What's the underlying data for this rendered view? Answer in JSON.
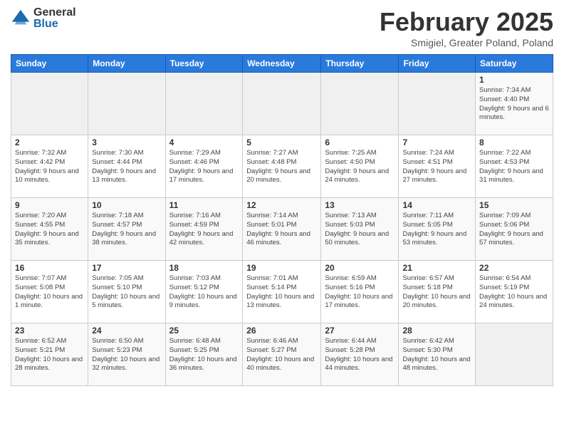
{
  "header": {
    "logo_general": "General",
    "logo_blue": "Blue",
    "month_title": "February 2025",
    "location": "Smigiel, Greater Poland, Poland"
  },
  "days_of_week": [
    "Sunday",
    "Monday",
    "Tuesday",
    "Wednesday",
    "Thursday",
    "Friday",
    "Saturday"
  ],
  "weeks": [
    [
      {
        "day": "",
        "info": ""
      },
      {
        "day": "",
        "info": ""
      },
      {
        "day": "",
        "info": ""
      },
      {
        "day": "",
        "info": ""
      },
      {
        "day": "",
        "info": ""
      },
      {
        "day": "",
        "info": ""
      },
      {
        "day": "1",
        "info": "Sunrise: 7:34 AM\nSunset: 4:40 PM\nDaylight: 9 hours and 6 minutes."
      }
    ],
    [
      {
        "day": "2",
        "info": "Sunrise: 7:32 AM\nSunset: 4:42 PM\nDaylight: 9 hours and 10 minutes."
      },
      {
        "day": "3",
        "info": "Sunrise: 7:30 AM\nSunset: 4:44 PM\nDaylight: 9 hours and 13 minutes."
      },
      {
        "day": "4",
        "info": "Sunrise: 7:29 AM\nSunset: 4:46 PM\nDaylight: 9 hours and 17 minutes."
      },
      {
        "day": "5",
        "info": "Sunrise: 7:27 AM\nSunset: 4:48 PM\nDaylight: 9 hours and 20 minutes."
      },
      {
        "day": "6",
        "info": "Sunrise: 7:25 AM\nSunset: 4:50 PM\nDaylight: 9 hours and 24 minutes."
      },
      {
        "day": "7",
        "info": "Sunrise: 7:24 AM\nSunset: 4:51 PM\nDaylight: 9 hours and 27 minutes."
      },
      {
        "day": "8",
        "info": "Sunrise: 7:22 AM\nSunset: 4:53 PM\nDaylight: 9 hours and 31 minutes."
      }
    ],
    [
      {
        "day": "9",
        "info": "Sunrise: 7:20 AM\nSunset: 4:55 PM\nDaylight: 9 hours and 35 minutes."
      },
      {
        "day": "10",
        "info": "Sunrise: 7:18 AM\nSunset: 4:57 PM\nDaylight: 9 hours and 38 minutes."
      },
      {
        "day": "11",
        "info": "Sunrise: 7:16 AM\nSunset: 4:59 PM\nDaylight: 9 hours and 42 minutes."
      },
      {
        "day": "12",
        "info": "Sunrise: 7:14 AM\nSunset: 5:01 PM\nDaylight: 9 hours and 46 minutes."
      },
      {
        "day": "13",
        "info": "Sunrise: 7:13 AM\nSunset: 5:03 PM\nDaylight: 9 hours and 50 minutes."
      },
      {
        "day": "14",
        "info": "Sunrise: 7:11 AM\nSunset: 5:05 PM\nDaylight: 9 hours and 53 minutes."
      },
      {
        "day": "15",
        "info": "Sunrise: 7:09 AM\nSunset: 5:06 PM\nDaylight: 9 hours and 57 minutes."
      }
    ],
    [
      {
        "day": "16",
        "info": "Sunrise: 7:07 AM\nSunset: 5:08 PM\nDaylight: 10 hours and 1 minute."
      },
      {
        "day": "17",
        "info": "Sunrise: 7:05 AM\nSunset: 5:10 PM\nDaylight: 10 hours and 5 minutes."
      },
      {
        "day": "18",
        "info": "Sunrise: 7:03 AM\nSunset: 5:12 PM\nDaylight: 10 hours and 9 minutes."
      },
      {
        "day": "19",
        "info": "Sunrise: 7:01 AM\nSunset: 5:14 PM\nDaylight: 10 hours and 13 minutes."
      },
      {
        "day": "20",
        "info": "Sunrise: 6:59 AM\nSunset: 5:16 PM\nDaylight: 10 hours and 17 minutes."
      },
      {
        "day": "21",
        "info": "Sunrise: 6:57 AM\nSunset: 5:18 PM\nDaylight: 10 hours and 20 minutes."
      },
      {
        "day": "22",
        "info": "Sunrise: 6:54 AM\nSunset: 5:19 PM\nDaylight: 10 hours and 24 minutes."
      }
    ],
    [
      {
        "day": "23",
        "info": "Sunrise: 6:52 AM\nSunset: 5:21 PM\nDaylight: 10 hours and 28 minutes."
      },
      {
        "day": "24",
        "info": "Sunrise: 6:50 AM\nSunset: 5:23 PM\nDaylight: 10 hours and 32 minutes."
      },
      {
        "day": "25",
        "info": "Sunrise: 6:48 AM\nSunset: 5:25 PM\nDaylight: 10 hours and 36 minutes."
      },
      {
        "day": "26",
        "info": "Sunrise: 6:46 AM\nSunset: 5:27 PM\nDaylight: 10 hours and 40 minutes."
      },
      {
        "day": "27",
        "info": "Sunrise: 6:44 AM\nSunset: 5:28 PM\nDaylight: 10 hours and 44 minutes."
      },
      {
        "day": "28",
        "info": "Sunrise: 6:42 AM\nSunset: 5:30 PM\nDaylight: 10 hours and 48 minutes."
      },
      {
        "day": "",
        "info": ""
      }
    ]
  ]
}
